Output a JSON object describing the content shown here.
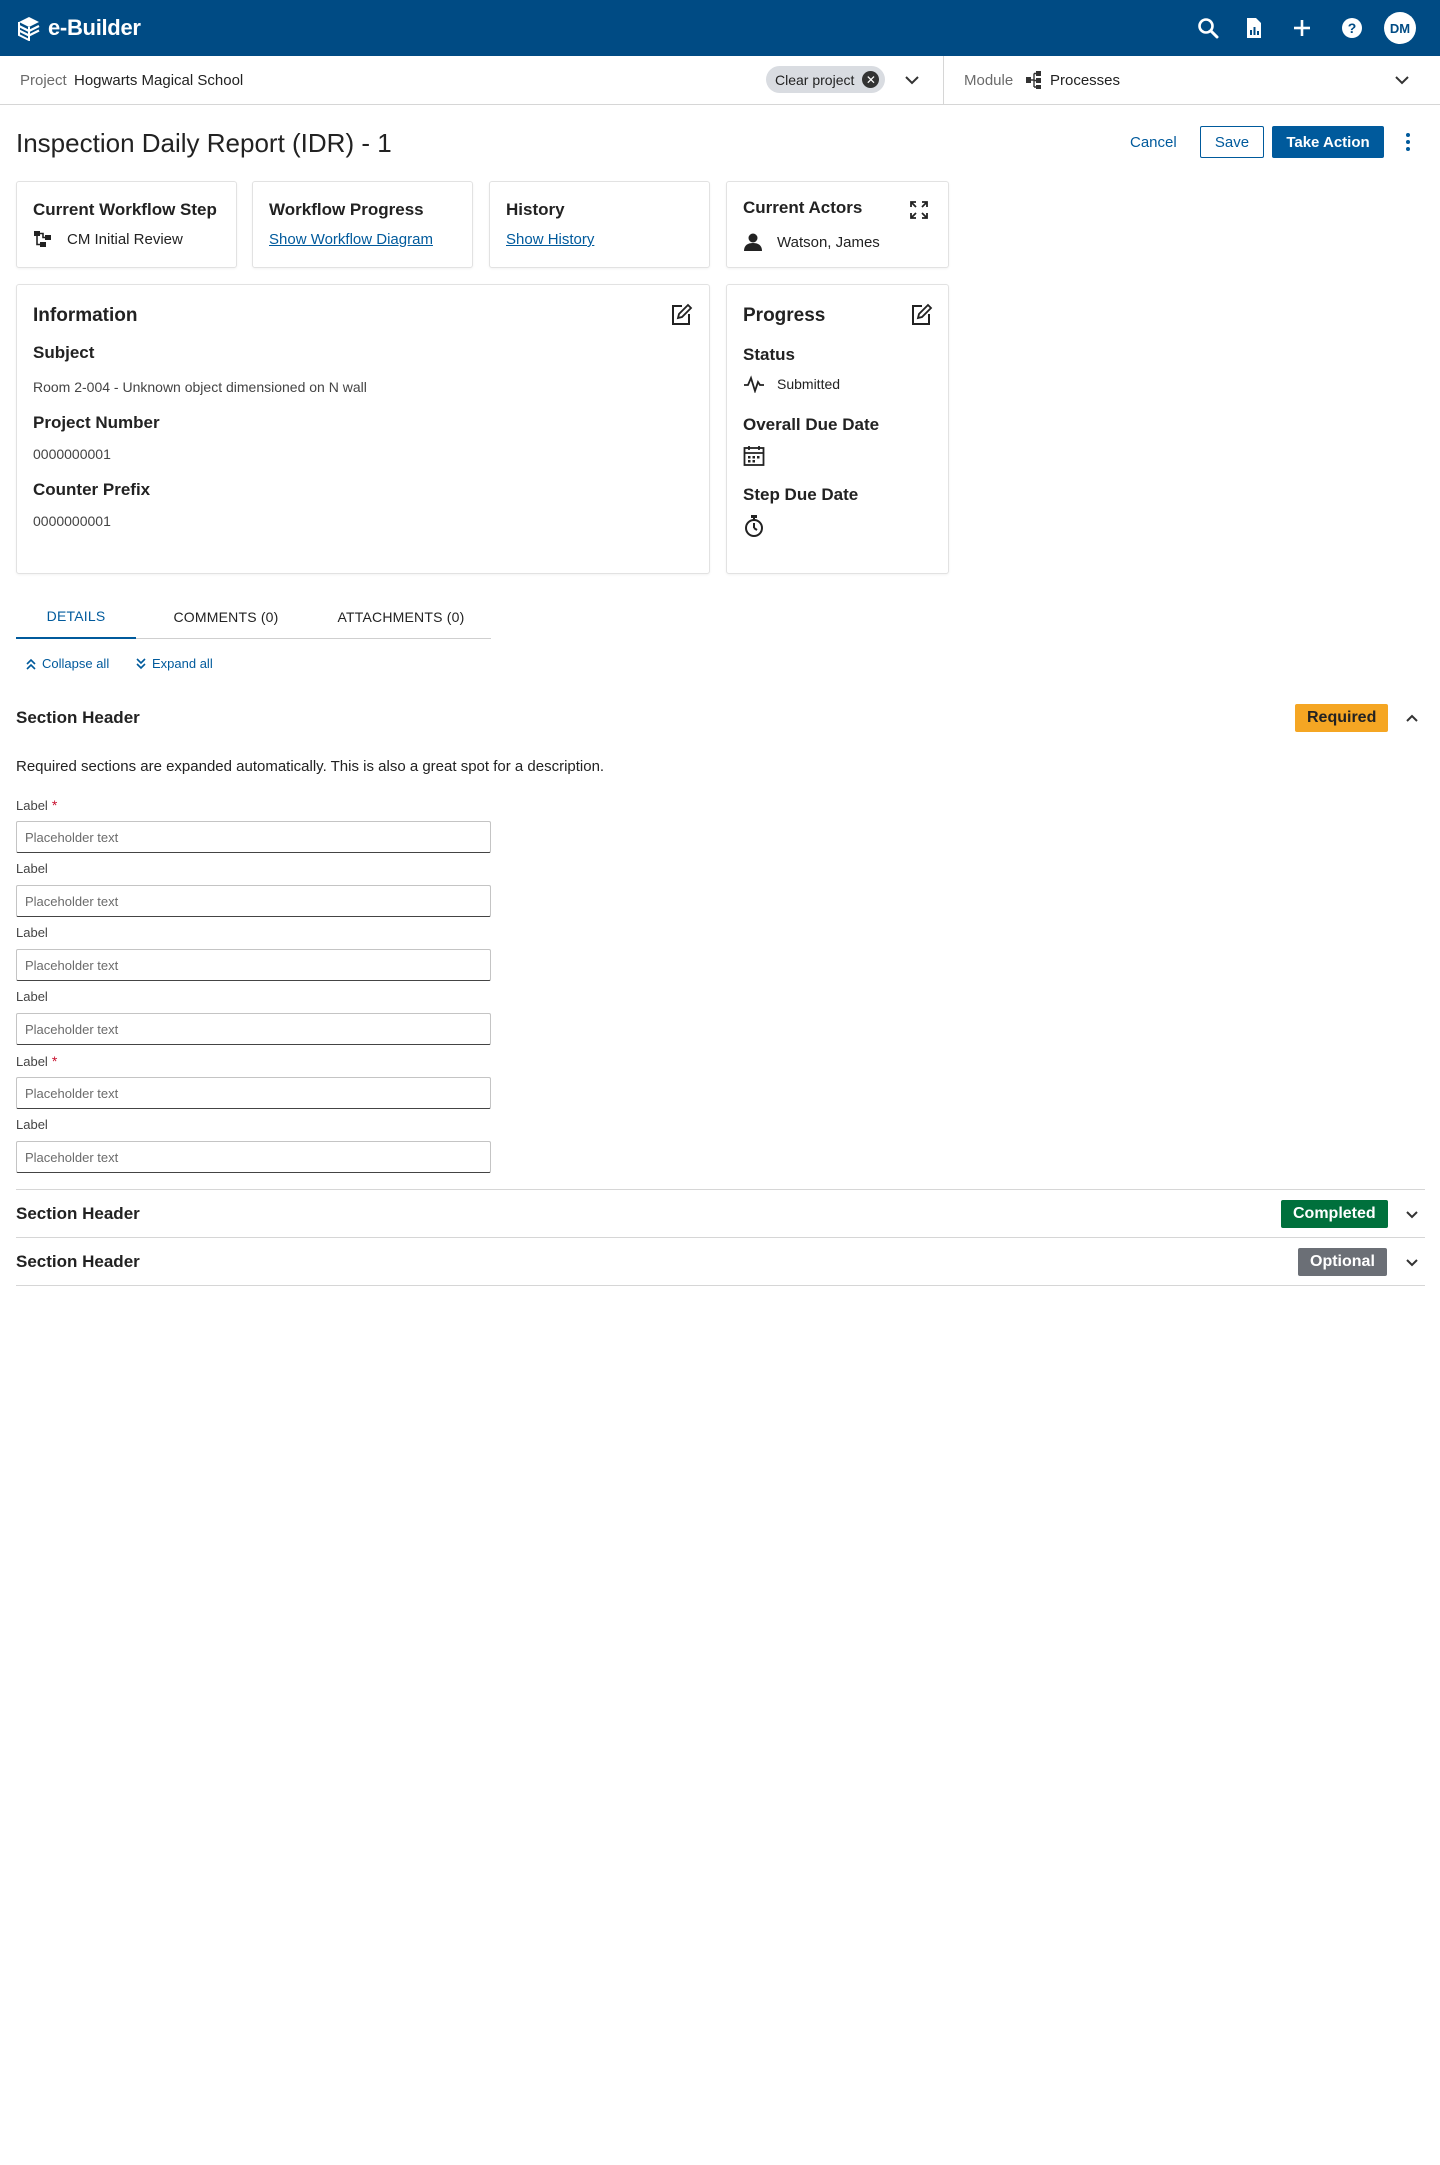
{
  "app": {
    "logo_text": "e-Builder",
    "avatar_initials": "DM"
  },
  "context": {
    "project_label": "Project",
    "project_value": "Hogwarts Magical School",
    "clear_project": "Clear project",
    "module_label": "Module",
    "module_value": "Processes"
  },
  "header": {
    "title": "Inspection Daily Report (IDR) - 1",
    "cancel_label": "Cancel",
    "save_label": "Save",
    "take_action_label": "Take Action"
  },
  "cards": {
    "workflow_step": {
      "title": "Current Workflow Step",
      "value": "CM Initial Review"
    },
    "workflow_progress": {
      "title": "Workflow Progress",
      "link": "Show Workflow Diagram"
    },
    "history": {
      "title": "History",
      "link": "Show History"
    },
    "actors": {
      "title": "Current Actors",
      "value": "Watson, James"
    }
  },
  "information": {
    "heading": "Information",
    "subject_label": "Subject",
    "subject_value": "Room 2-004 - Unknown object dimensioned on N wall",
    "project_number_label": "Project Number",
    "project_number_value": "0000000001",
    "counter_prefix_label": "Counter Prefix",
    "counter_prefix_value": "0000000001"
  },
  "progress": {
    "heading": "Progress",
    "status_label": "Status",
    "status_value": "Submitted",
    "overall_due_label": "Overall Due Date",
    "step_due_label": "Step Due Date"
  },
  "tabs": [
    {
      "label": "DETAILS"
    },
    {
      "label": "COMMENTS (0)"
    },
    {
      "label": "ATTACHMENTS (0)"
    }
  ],
  "controls": {
    "collapse_all": "Collapse all",
    "expand_all": "Expand all"
  },
  "sections": [
    {
      "title": "Section Header",
      "badge": "Required",
      "badge_color": "#f5a623",
      "badge_text_color": "#222222",
      "description": "Required sections are expanded automatically. This is also a great spot for a description.",
      "fields": [
        {
          "label": "Label",
          "required": "*",
          "placeholder": "Placeholder text"
        },
        {
          "label": "Label",
          "required": "",
          "placeholder": "Placeholder text"
        },
        {
          "label": "Label",
          "required": "",
          "placeholder": "Placeholder text"
        },
        {
          "label": "Label",
          "required": "",
          "placeholder": "Placeholder text"
        },
        {
          "label": "Label",
          "required": "*",
          "placeholder": "Placeholder text"
        },
        {
          "label": "Label",
          "required": "",
          "placeholder": "Placeholder text"
        }
      ]
    },
    {
      "title": "Section Header",
      "badge": "Completed",
      "badge_color": "#00703c",
      "badge_text_color": "#ffffff"
    },
    {
      "title": "Section Header",
      "badge": "Optional",
      "badge_color": "#6b6f76",
      "badge_text_color": "#ffffff"
    }
  ],
  "colors": {
    "brand": "#004b84",
    "accent": "#005a9c",
    "required": "#c8102e"
  }
}
